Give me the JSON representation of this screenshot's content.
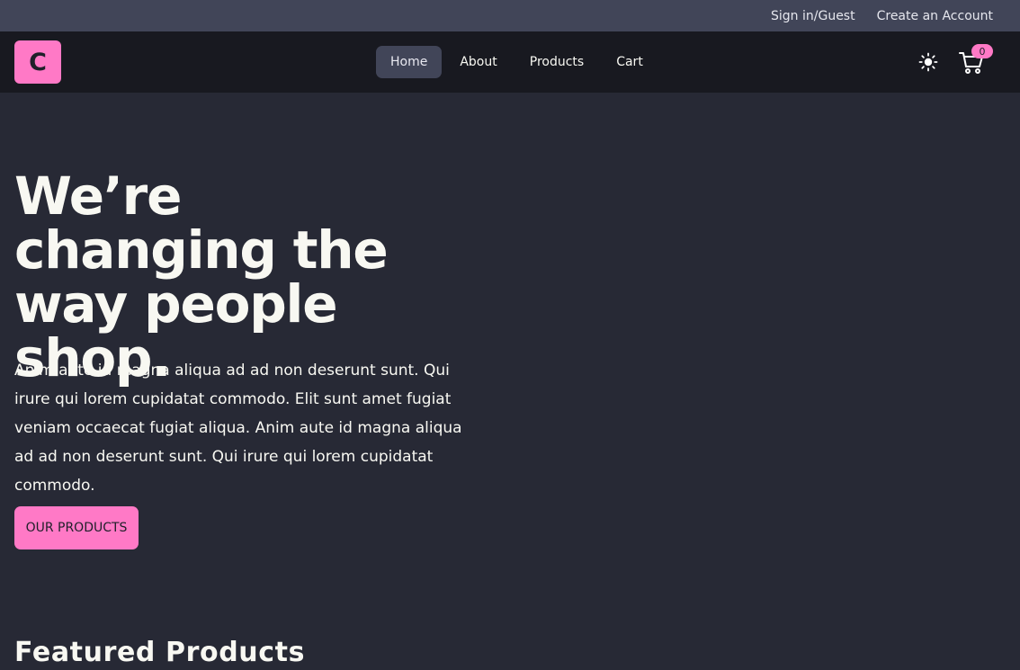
{
  "topbar": {
    "sign_in": "Sign in/Guest",
    "create_account": "Create an Account"
  },
  "navbar": {
    "logo": "C",
    "links": [
      {
        "label": "Home",
        "active": true
      },
      {
        "label": "About",
        "active": false
      },
      {
        "label": "Products",
        "active": false
      },
      {
        "label": "Cart",
        "active": false
      }
    ],
    "theme_icon": "sun-icon",
    "cart_icon": "cart-icon",
    "cart_count": "0"
  },
  "hero": {
    "title": "We’re changing the way people shop.",
    "text": "Anim aute id magna aliqua ad ad non deserunt sunt. Qui irure qui lorem cupidatat commodo. Elit sunt amet fugiat veniam occaecat fugiat aliqua. Anim aute id magna aliqua ad ad non deserunt sunt. Qui irure qui lorem cupidatat commodo.",
    "button": "OUR PRODUCTS"
  },
  "featured": {
    "title": "Featured Products"
  },
  "colors": {
    "accent": "#ff79c6",
    "background": "#272935",
    "navbar": "#181920",
    "topbar": "#414558"
  }
}
